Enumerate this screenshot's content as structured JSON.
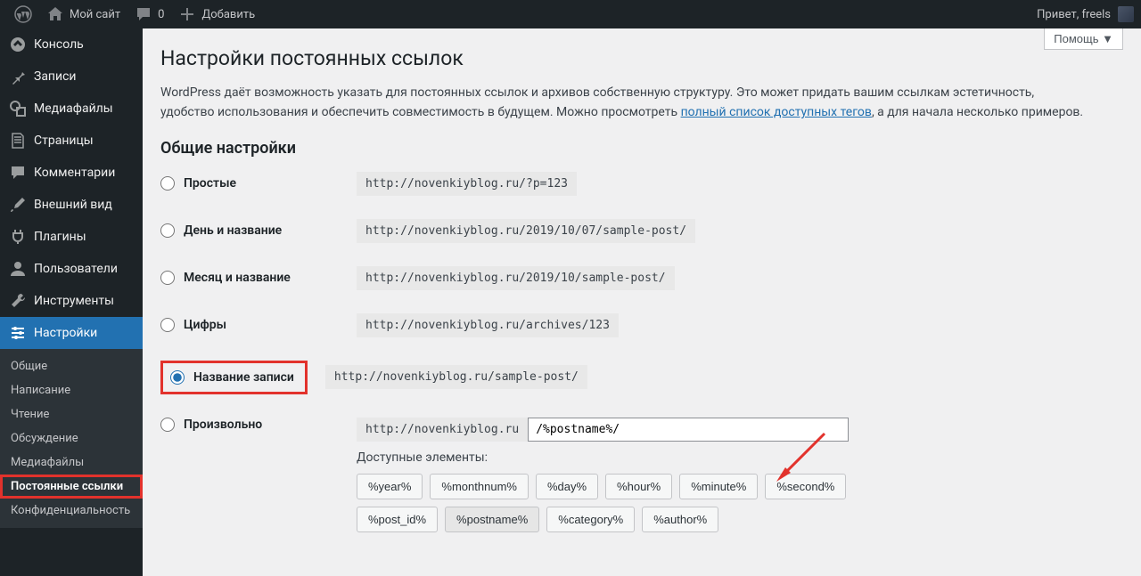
{
  "adminbar": {
    "site_name": "Мой сайт",
    "comments_count": "0",
    "add_new": "Добавить",
    "greeting": "Привет, freels"
  },
  "sidebar": {
    "items": [
      {
        "id": "dashboard",
        "label": "Консоль"
      },
      {
        "id": "posts",
        "label": "Записи"
      },
      {
        "id": "media",
        "label": "Медиафайлы"
      },
      {
        "id": "pages",
        "label": "Страницы"
      },
      {
        "id": "comments",
        "label": "Комментарии"
      },
      {
        "id": "appearance",
        "label": "Внешний вид"
      },
      {
        "id": "plugins",
        "label": "Плагины"
      },
      {
        "id": "users",
        "label": "Пользователи"
      },
      {
        "id": "tools",
        "label": "Инструменты"
      },
      {
        "id": "settings",
        "label": "Настройки"
      }
    ],
    "submenu": [
      {
        "label": "Общие"
      },
      {
        "label": "Написание"
      },
      {
        "label": "Чтение"
      },
      {
        "label": "Обсуждение"
      },
      {
        "label": "Медиафайлы"
      },
      {
        "label": "Постоянные ссылки"
      },
      {
        "label": "Конфиденциальность"
      }
    ]
  },
  "content": {
    "help_button": "Помощь ▼",
    "title": "Настройки постоянных ссылок",
    "intro_a": "WordPress даёт возможность указать для постоянных ссылок и архивов собственную структуру. Это может придать вашим ссылкам эстетичность, удобство использования и обеспечить совместимость в будущем. Можно просмотреть ",
    "intro_link": "полный список доступных тегов",
    "intro_b": ", а для начала несколько примеров.",
    "section_title": "Общие настройки",
    "options": [
      {
        "label": "Простые",
        "sample": "http://novenkiyblog.ru/?p=123"
      },
      {
        "label": "День и название",
        "sample": "http://novenkiyblog.ru/2019/10/07/sample-post/"
      },
      {
        "label": "Месяц и название",
        "sample": "http://novenkiyblog.ru/2019/10/sample-post/"
      },
      {
        "label": "Цифры",
        "sample": "http://novenkiyblog.ru/archives/123"
      },
      {
        "label": "Название записи",
        "sample": "http://novenkiyblog.ru/sample-post/"
      },
      {
        "label": "Произвольно"
      }
    ],
    "custom": {
      "prefix": "http://novenkiyblog.ru",
      "value": "/%postname%/",
      "tags_label": "Доступные элементы:",
      "tags": [
        "%year%",
        "%monthnum%",
        "%day%",
        "%hour%",
        "%minute%",
        "%second%",
        "%post_id%",
        "%postname%",
        "%category%",
        "%author%"
      ]
    }
  }
}
